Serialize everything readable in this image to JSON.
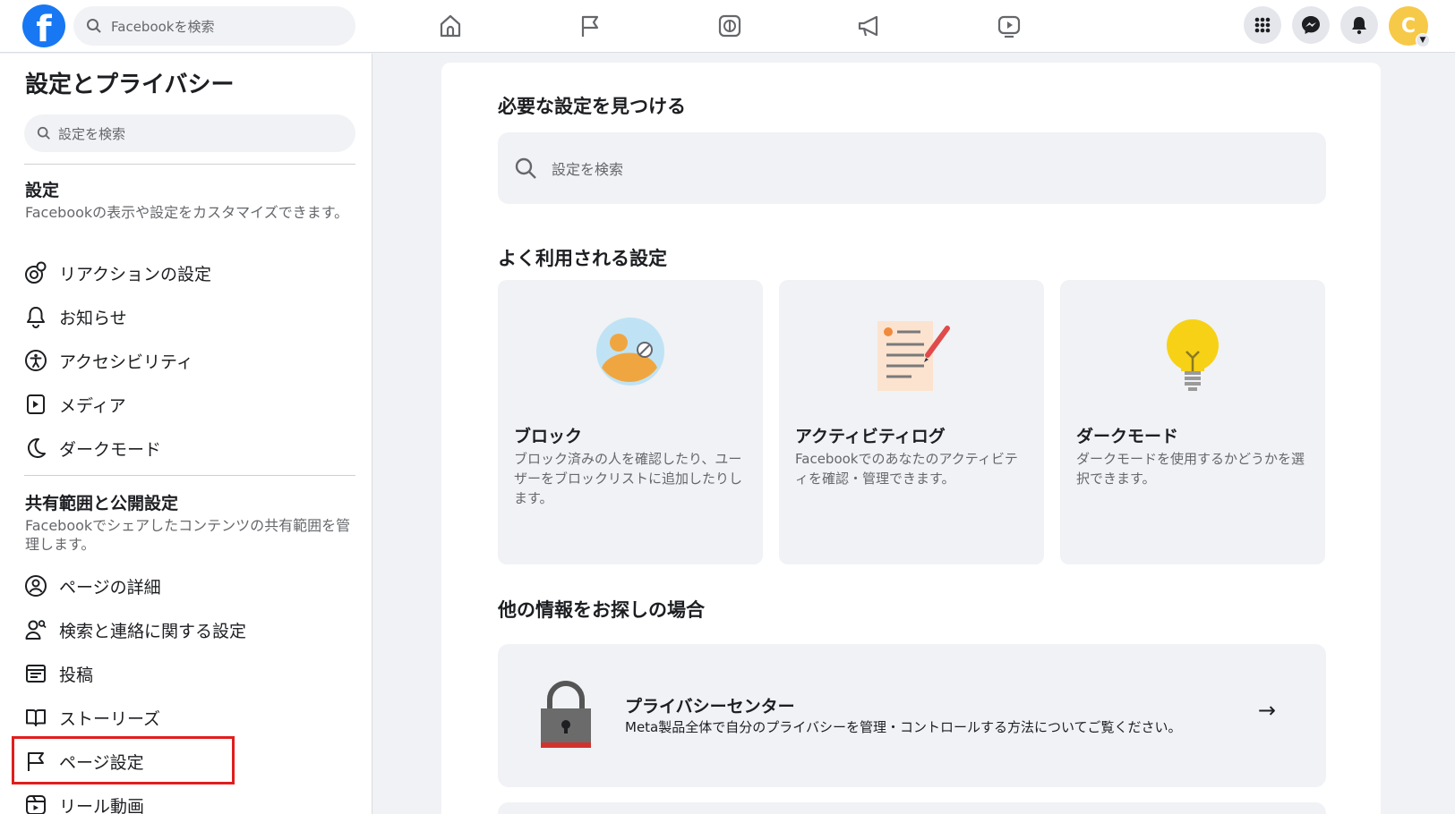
{
  "topbar": {
    "search_placeholder": "Facebookを検索",
    "avatar_initial": "C"
  },
  "sidebar": {
    "title": "設定とプライバシー",
    "search_placeholder": "設定を検索",
    "section1": {
      "title": "設定",
      "desc": "Facebookの表示や設定をカスタマイズできます。",
      "items": [
        "リアクションの設定",
        "お知らせ",
        "アクセシビリティ",
        "メディア",
        "ダークモード"
      ]
    },
    "section2": {
      "title": "共有範囲と公開設定",
      "desc": "Facebookでシェアしたコンテンツの共有範囲を管理します。",
      "items": [
        "ページの詳細",
        "検索と連絡に関する設定",
        "投稿",
        "ストーリーズ",
        "ページ設定",
        "リール動画"
      ]
    }
  },
  "main": {
    "find_heading": "必要な設定を見つける",
    "search_placeholder": "設定を検索",
    "common_heading": "よく利用される設定",
    "tiles": [
      {
        "title": "ブロック",
        "desc": "ブロック済みの人を確認したり、ユーザーをブロックリストに追加したりします。",
        "icon": "block-person-icon"
      },
      {
        "title": "アクティビティログ",
        "desc": "Facebookでのあなたのアクティビティを確認・管理できます。",
        "icon": "activity-log-icon"
      },
      {
        "title": "ダークモード",
        "desc": "ダークモードを使用するかどうかを選択できます。",
        "icon": "lightbulb-icon"
      }
    ],
    "other_heading": "他の情報をお探しの場合",
    "privacy_center": {
      "title": "プライバシーセンター",
      "desc": "Meta製品全体で自分のプライバシーを管理・コントロールする方法についてご覧ください。"
    }
  },
  "colors": {
    "brand": "#1877f2",
    "highlight": "#e01e1e"
  }
}
